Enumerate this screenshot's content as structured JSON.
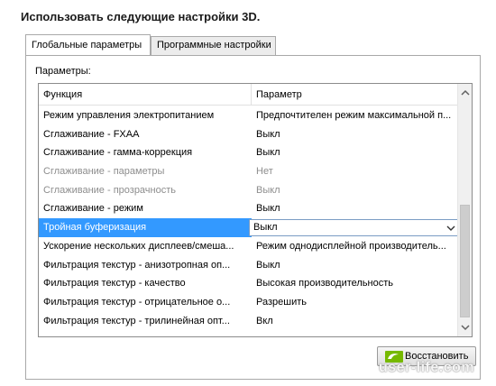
{
  "heading": "Использовать следующие настройки 3D.",
  "tabs": [
    {
      "label": "Глобальные параметры",
      "active": true
    },
    {
      "label": "Программные настройки",
      "active": false
    }
  ],
  "params_label": "Параметры:",
  "columns": {
    "function": "Функция",
    "parameter": "Параметр"
  },
  "rows": [
    {
      "function": "Режим управления электропитанием",
      "value": "Предпочтителен режим максимальной п..."
    },
    {
      "function": "Сглаживание - FXAA",
      "value": "Выкл"
    },
    {
      "function": "Сглаживание - гамма-коррекция",
      "value": "Выкл"
    },
    {
      "function": "Сглаживание - параметры",
      "value": "Нет"
    },
    {
      "function": "Сглаживание - прозрачность",
      "value": "Выкл"
    },
    {
      "function": "Сглаживание - режим",
      "value": "Выкл"
    },
    {
      "function": "Тройная буферизация",
      "value": "Выкл"
    },
    {
      "function": "Ускорение нескольких дисплеев/смеша...",
      "value": "Режим однодисплейной производитель..."
    },
    {
      "function": "Фильтрация текстур - анизотропная оп...",
      "value": "Выкл"
    },
    {
      "function": "Фильтрация текстур - качество",
      "value": "Высокая производительность"
    },
    {
      "function": "Фильтрация текстур - отрицательное о...",
      "value": "Разрешить"
    },
    {
      "function": "Фильтрация текстур - трилинейная опт...",
      "value": "Вкл"
    }
  ],
  "disabled_rows": [
    3,
    4
  ],
  "selected_row": 6,
  "restore_button": {
    "label": "Восстановить",
    "icon": "nvidia-logo-icon"
  },
  "watermark": "user-life.com",
  "colors": {
    "selection": "#3399ff",
    "disabled_text": "#8d8d8d",
    "nvidia_green": "#76b900"
  }
}
